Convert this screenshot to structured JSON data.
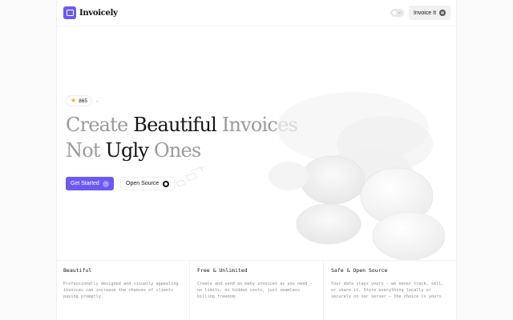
{
  "nav": {
    "brand": "Invoicely",
    "cta_label": "Invoice It"
  },
  "hero": {
    "stars": "865",
    "headline_line1": [
      {
        "text": "Create ",
        "strong": false
      },
      {
        "text": "Beautiful",
        "strong": true
      },
      {
        "text": " Invoices",
        "strong": false
      }
    ],
    "headline_line2": [
      {
        "text": "Not ",
        "strong": false
      },
      {
        "text": "Ugly",
        "strong": true
      },
      {
        "text": " Ones",
        "strong": false
      }
    ],
    "primary_button": "Get Started",
    "secondary_button": "Open Source"
  },
  "features": [
    {
      "title": "Beautiful",
      "desc": "Professionally designed and visually appealing invoices can increase the chances of clients paying promptly."
    },
    {
      "title": "Free & Unlimited",
      "desc": "Create and send as many invoices as you need — no limits, no hidden costs, just seamless billing freedom."
    },
    {
      "title": "Safe & Open Source",
      "desc": "Your data stays yours — we never track, sell, or share it. Store everything locally or securely on our server — the choice is yours."
    }
  ],
  "colors": {
    "accent": "#6a5af0",
    "star": "#f2b01e",
    "headline_muted": "#9a9a9a",
    "headline_strong": "#141414"
  },
  "icons": [
    "logo-mark",
    "theme-toggle",
    "github-icon",
    "star-icon",
    "arrow-right-icon"
  ]
}
